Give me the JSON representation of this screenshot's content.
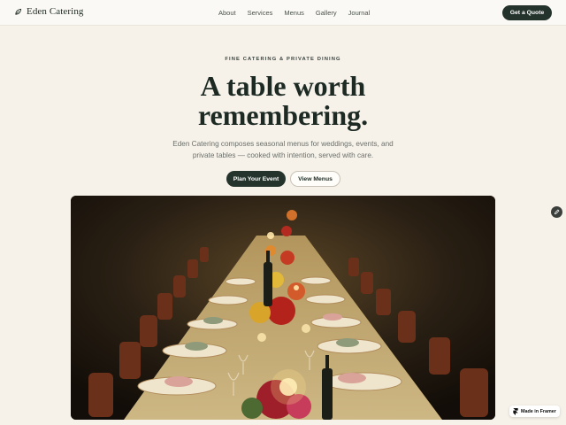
{
  "nav": {
    "brand": "Eden Catering",
    "links": [
      "About",
      "Services",
      "Menus",
      "Gallery",
      "Journal"
    ],
    "cta": "Get a Quote"
  },
  "hero": {
    "kicker": "FINE CATERING & PRIVATE DINING",
    "headline_line1": "A table worth",
    "headline_line2": "remembering.",
    "subtitle": "Eden Catering composes seasonal menus for weddings, events, and private tables — cooked with intention, served with care.",
    "primary_cta": "Plan Your Event",
    "secondary_cta": "View Menus",
    "image_subject": "candlelit long banquet table with flowers"
  },
  "badge": {
    "label": "Made in Framer"
  },
  "icons": {
    "brand": "leaf-icon",
    "edit": "pencil-icon",
    "badge": "framer-icon"
  },
  "colors": {
    "background": "#f6f2ea",
    "accent": "#24332c",
    "text": "#1d2a24",
    "muted": "#6a6f69"
  }
}
